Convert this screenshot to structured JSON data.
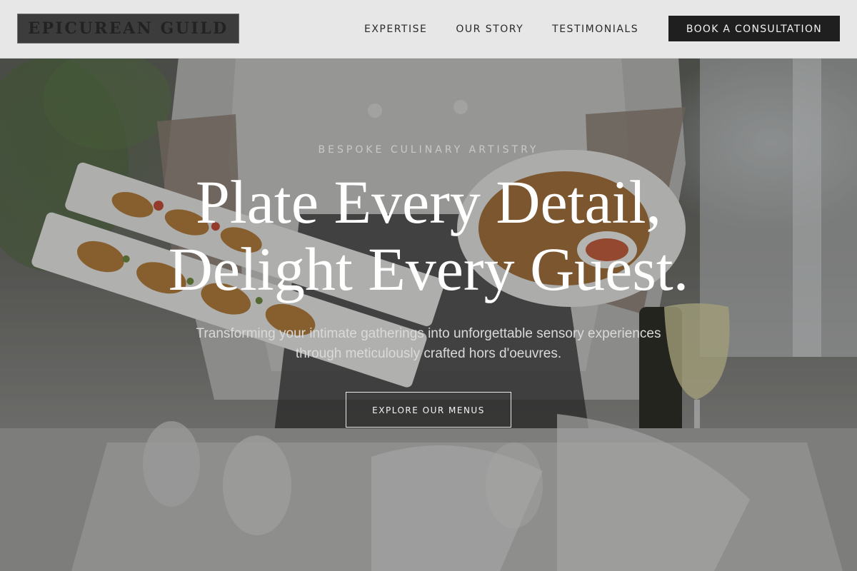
{
  "header": {
    "logo_text": "EPICUREAN GUILD",
    "nav": [
      {
        "label": "EXPERTISE"
      },
      {
        "label": "OUR STORY"
      },
      {
        "label": "TESTIMONIALS"
      }
    ],
    "cta_label": "BOOK A CONSULTATION"
  },
  "hero": {
    "eyebrow": "BESPOKE CULINARY ARTISTRY",
    "headline_line1": "Plate Every Detail,",
    "headline_line2": "Delight Every Guest.",
    "subtext": "Transforming your intimate gatherings into unforgettable sensory experiences through meticulously crafted hors d'oeuvres.",
    "button_label": "EXPLORE OUR MENUS"
  },
  "colors": {
    "header_bg": "#ececec",
    "logo_bg": "#3c3c3c",
    "cta_bg": "#1f1f1f",
    "headline": "#ffffff"
  }
}
